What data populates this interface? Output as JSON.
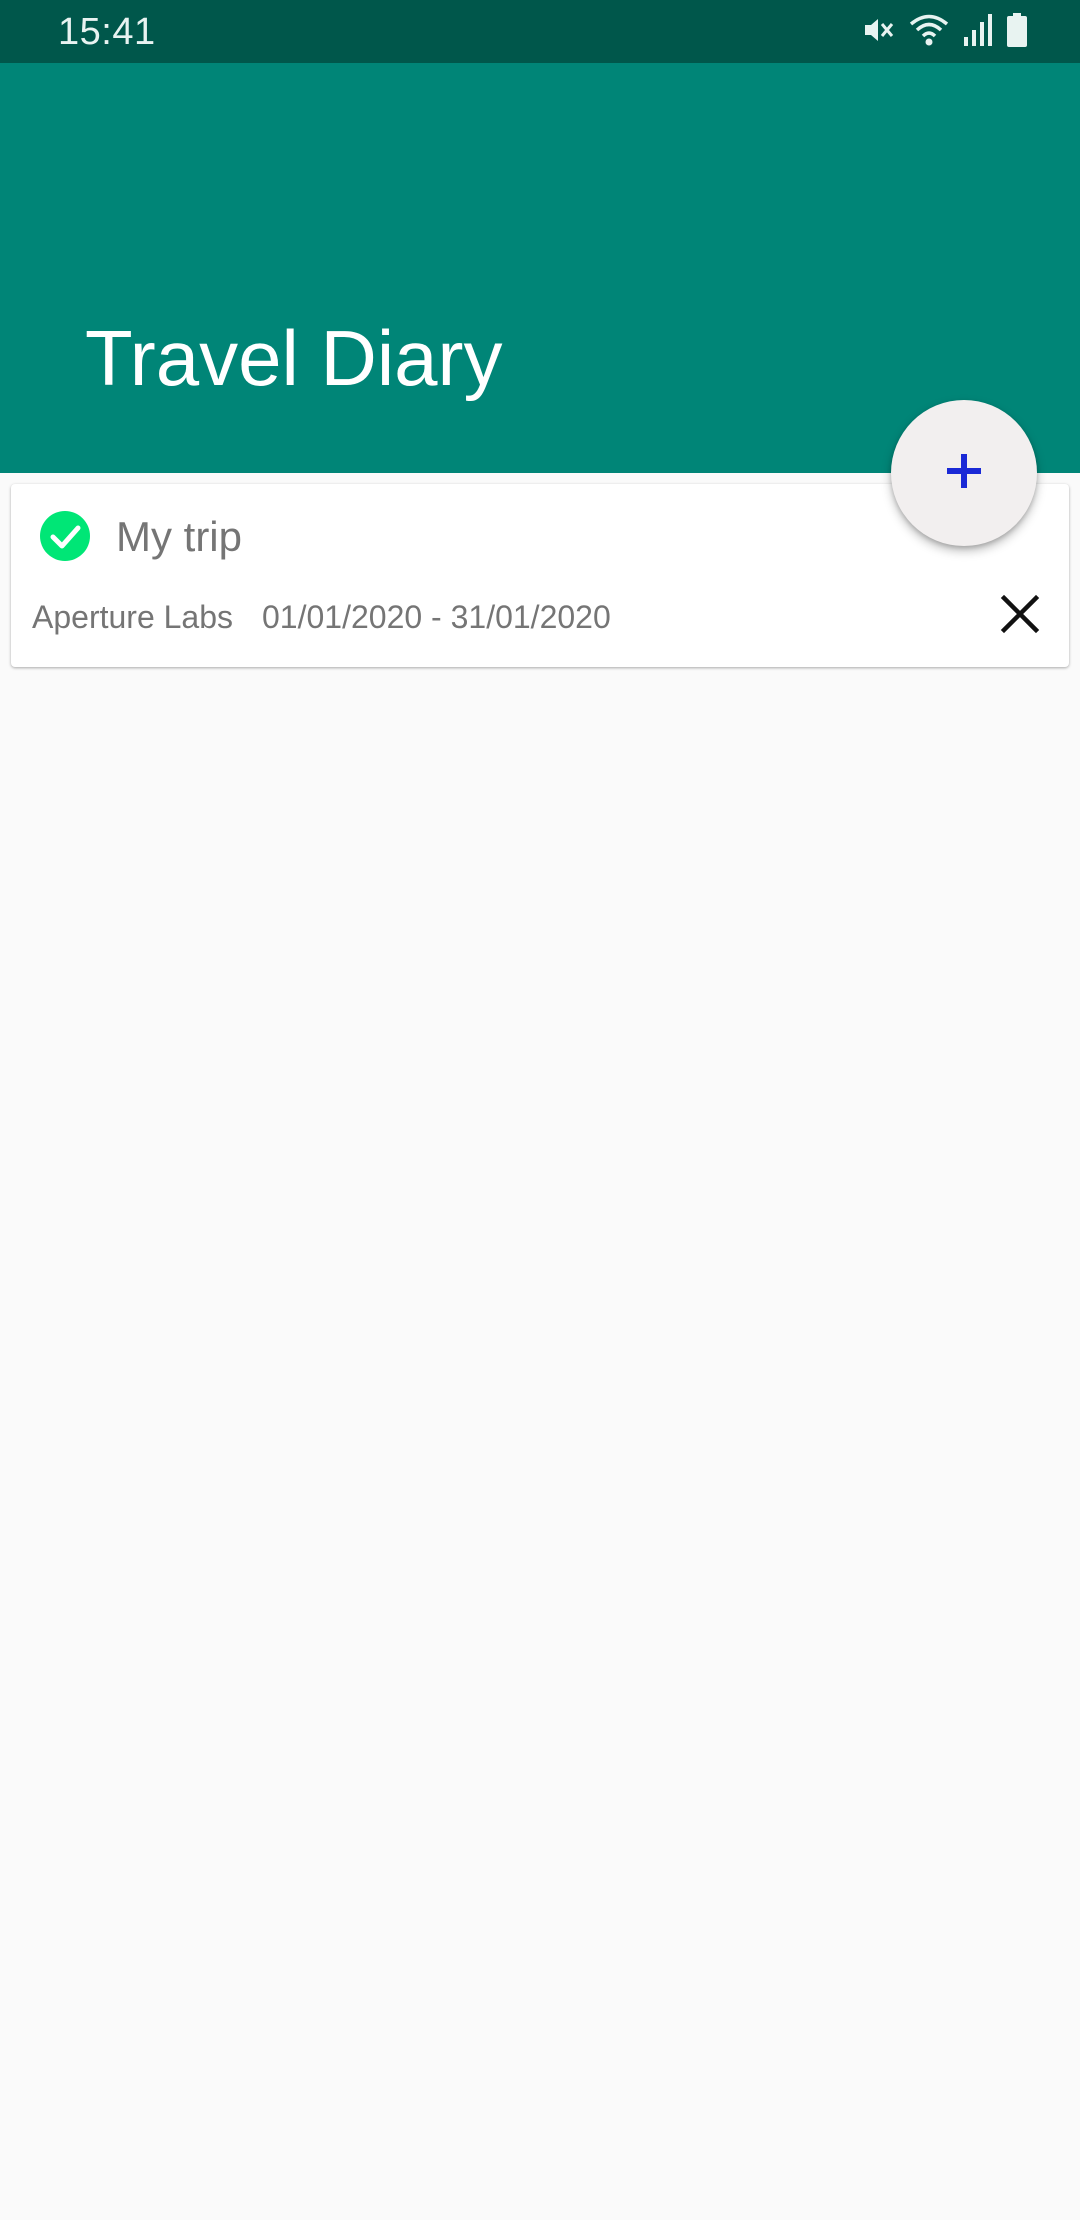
{
  "status_bar": {
    "time": "15:41",
    "icons": [
      "mute-icon",
      "wifi-icon",
      "signal-icon",
      "battery-icon"
    ]
  },
  "app_bar": {
    "title": "Travel Diary",
    "color": "#008577"
  },
  "trips": [
    {
      "name": "My trip",
      "company": "Aperture Labs",
      "dates": "01/01/2020 - 31/01/2020",
      "status_icon": "check-circle-icon",
      "status_color": "#00e676",
      "delete_icon": "close-icon"
    }
  ],
  "fab": {
    "icon": "plus-icon",
    "icon_color": "#1a29d6"
  }
}
